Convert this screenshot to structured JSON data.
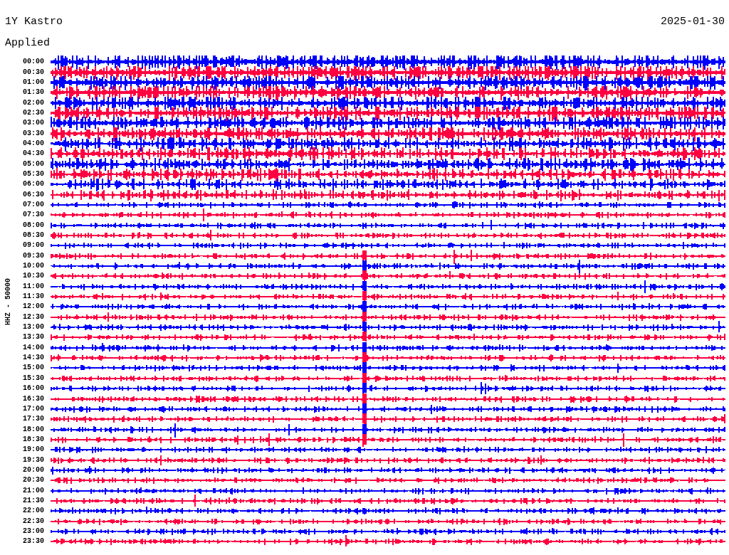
{
  "title": "1Y Kastro",
  "date": "2025-01-30",
  "filter_label": "Applied",
  "channel_label": "HHZ - 50000",
  "rows": [
    {
      "time": "00:00",
      "color": "#0000ff"
    },
    {
      "time": "00:30",
      "color": "#ff0040"
    },
    {
      "time": "01:00",
      "color": "#0000ff"
    },
    {
      "time": "01:30",
      "color": "#ff0040"
    },
    {
      "time": "02:00",
      "color": "#0000ff"
    },
    {
      "time": "02:30",
      "color": "#ff0040"
    },
    {
      "time": "03:00",
      "color": "#0000ff"
    },
    {
      "time": "03:30",
      "color": "#ff0040"
    },
    {
      "time": "04:00",
      "color": "#0000ff"
    },
    {
      "time": "04:30",
      "color": "#ff0040"
    },
    {
      "time": "05:00",
      "color": "#0000ff"
    },
    {
      "time": "05:30",
      "color": "#ff0040"
    },
    {
      "time": "06:00",
      "color": "#0000ff"
    },
    {
      "time": "06:30",
      "color": "#ff0040"
    },
    {
      "time": "07:00",
      "color": "#0000ff"
    },
    {
      "time": "07:30",
      "color": "#ff0040"
    },
    {
      "time": "08:00",
      "color": "#0000ff"
    },
    {
      "time": "08:30",
      "color": "#ff0040"
    },
    {
      "time": "09:00",
      "color": "#0000ff"
    },
    {
      "time": "09:30",
      "color": "#ff0040"
    },
    {
      "time": "10:00",
      "color": "#0000ff"
    },
    {
      "time": "10:30",
      "color": "#ff0040"
    },
    {
      "time": "11:00",
      "color": "#0000ff"
    },
    {
      "time": "11:30",
      "color": "#ff0040"
    },
    {
      "time": "12:00",
      "color": "#0000ff"
    },
    {
      "time": "12:30",
      "color": "#ff0040"
    },
    {
      "time": "13:00",
      "color": "#0000ff"
    },
    {
      "time": "13:30",
      "color": "#ff0040"
    },
    {
      "time": "14:00",
      "color": "#0000ff"
    },
    {
      "time": "14:30",
      "color": "#ff0040"
    },
    {
      "time": "15:00",
      "color": "#0000ff"
    },
    {
      "time": "15:30",
      "color": "#ff0040"
    },
    {
      "time": "16:00",
      "color": "#0000ff"
    },
    {
      "time": "16:30",
      "color": "#ff0040"
    },
    {
      "time": "17:00",
      "color": "#0000ff"
    },
    {
      "time": "17:30",
      "color": "#ff0040"
    },
    {
      "time": "18:00",
      "color": "#0000ff"
    },
    {
      "time": "18:30",
      "color": "#ff0040"
    },
    {
      "time": "19:00",
      "color": "#0000ff"
    },
    {
      "time": "19:30",
      "color": "#ff0040"
    },
    {
      "time": "20:00",
      "color": "#0000ff"
    },
    {
      "time": "20:30",
      "color": "#ff0040"
    },
    {
      "time": "21:00",
      "color": "#0000ff"
    },
    {
      "time": "21:30",
      "color": "#ff0040"
    },
    {
      "time": "22:00",
      "color": "#0000ff"
    },
    {
      "time": "22:30",
      "color": "#ff0040"
    },
    {
      "time": "23:00",
      "color": "#0000ff"
    },
    {
      "time": "23:30",
      "color": "#ff0040"
    }
  ]
}
